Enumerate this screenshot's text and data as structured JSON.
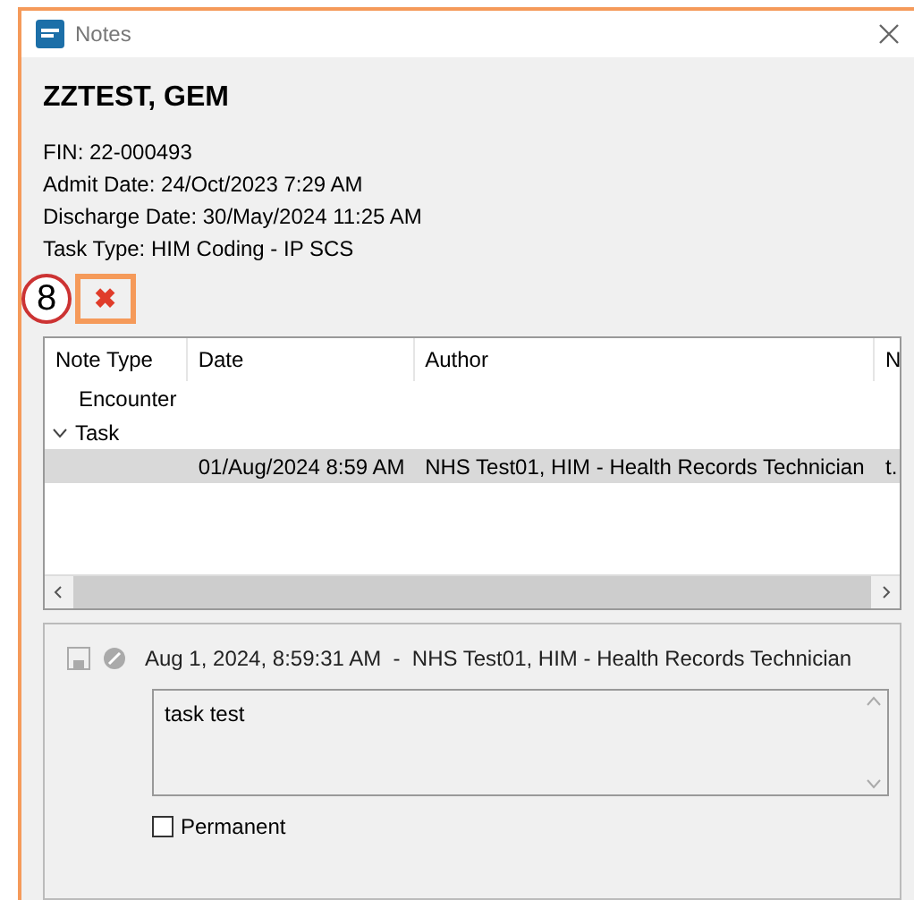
{
  "window": {
    "title": "Notes"
  },
  "patient": {
    "name": "ZZTEST, GEM",
    "details": [
      "FIN: 22-000493",
      "Admit Date: 24/Oct/2023 7:29 AM",
      "Discharge Date: 30/May/2024 11:25 AM",
      "Task Type: HIM Coding - IP SCS"
    ]
  },
  "step_badge": "8",
  "delete_button": {
    "label": "✖"
  },
  "table": {
    "columns": [
      "Note Type",
      "Date",
      "Author",
      "N"
    ],
    "rows": [
      {
        "note_type": "Encounter",
        "selected": false,
        "children": []
      },
      {
        "note_type": "Task",
        "selected": false,
        "expanded": true,
        "children": [
          {
            "date": "01/Aug/2024 8:59 AM",
            "author": "NHS Test01, HIM - Health Records Technician",
            "note": "t.",
            "selected": true
          }
        ]
      }
    ]
  },
  "note": {
    "header": "Aug 1, 2024, 8:59:31 AM  -  NHS Test01, HIM - Health Records Technician",
    "text": "task test",
    "permanent": {
      "label": "Permanent",
      "checked": false
    }
  }
}
